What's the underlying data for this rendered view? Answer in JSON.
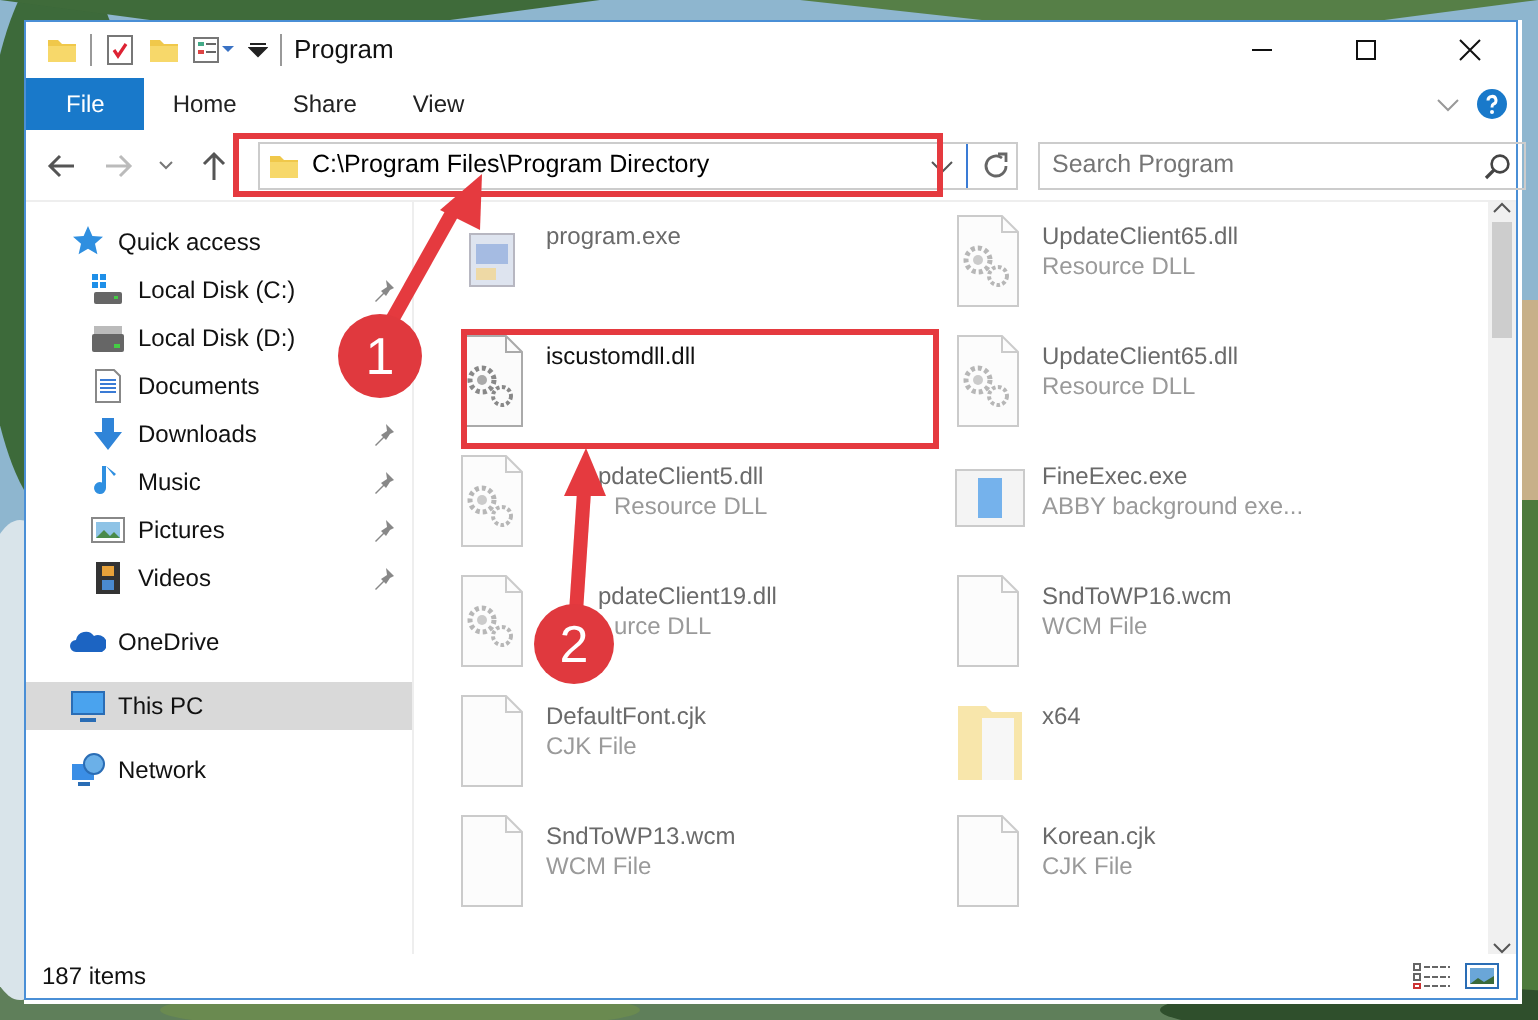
{
  "window": {
    "title": "Program"
  },
  "ribbon_tabs": [
    {
      "label": "File",
      "selected": true
    },
    {
      "label": "Home",
      "selected": false
    },
    {
      "label": "Share",
      "selected": false
    },
    {
      "label": "View",
      "selected": false
    }
  ],
  "address": {
    "path": "C:\\Program Files\\Program Directory"
  },
  "search": {
    "placeholder": "Search Program"
  },
  "sidebar": {
    "items": [
      {
        "label": "Quick access",
        "kind": "star",
        "selected": false,
        "children": [
          {
            "label": "Local Disk (C:)",
            "kind": "drive-system",
            "pinned": true,
            "selected": false
          },
          {
            "label": "Local Disk (D:)",
            "kind": "drive",
            "pinned": false,
            "selected": false
          },
          {
            "label": "Documents",
            "kind": "documents",
            "pinned": false,
            "selected": false
          },
          {
            "label": "Downloads",
            "kind": "downloads",
            "pinned": true,
            "selected": false
          },
          {
            "label": "Music",
            "kind": "music",
            "pinned": true,
            "selected": false
          },
          {
            "label": "Pictures",
            "kind": "pictures",
            "pinned": true,
            "selected": false
          },
          {
            "label": "Videos",
            "kind": "videos",
            "pinned": true,
            "selected": false
          }
        ]
      },
      {
        "label": "OneDrive",
        "kind": "cloud",
        "selected": false
      },
      {
        "label": "This PC",
        "kind": "pc",
        "selected": true
      },
      {
        "label": "Network",
        "kind": "network",
        "selected": false
      }
    ]
  },
  "files": [
    {
      "name": "program.exe",
      "kind": "exe",
      "blurred": true
    },
    {
      "name": "UpdateClient65.dll",
      "type": "Resource DLL",
      "kind": "dll",
      "blurred": true
    },
    {
      "name": "iscustomdll.dll",
      "kind": "dll",
      "blurred": false
    },
    {
      "name": "UpdateClient65.dll",
      "type": "Resource DLL",
      "kind": "dll",
      "blurred": true
    },
    {
      "name": "pdateClient5.dll",
      "type": "Resource DLL",
      "kind": "dll",
      "blurred": true,
      "name_covered": true,
      "type_covered": true
    },
    {
      "name": "FineExec.exe",
      "type": "ABBY background exe...",
      "kind": "app",
      "blurred": true
    },
    {
      "name": "pdateClient19.dll",
      "type": "urce DLL",
      "kind": "dll",
      "blurred": true,
      "name_covered": true,
      "type_covered": true
    },
    {
      "name": "SndToWP16.wcm",
      "type": "WCM File",
      "kind": "doc",
      "blurred": true
    },
    {
      "name": "DefaultFont.cjk",
      "type": "CJK File",
      "kind": "doc",
      "blurred": true
    },
    {
      "name": "x64",
      "kind": "folder",
      "blurred": true
    },
    {
      "name": "SndToWP13.wcm",
      "type": "WCM File",
      "kind": "doc",
      "blurred": true
    },
    {
      "name": "Korean.cjk",
      "type": "CJK File",
      "kind": "doc",
      "blurred": true
    }
  ],
  "status_bar": {
    "count": "187 items"
  },
  "callouts": [
    {
      "number": "1"
    },
    {
      "number": "2"
    }
  ]
}
